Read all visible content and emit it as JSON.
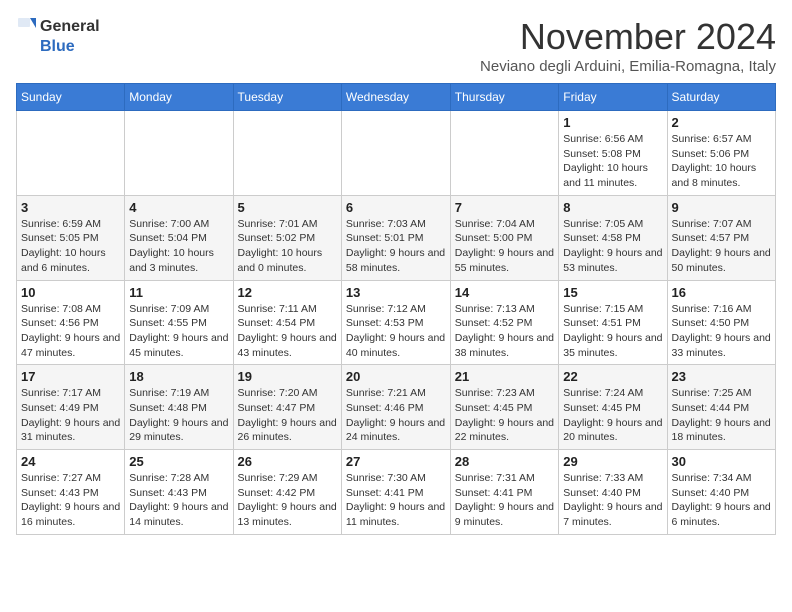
{
  "header": {
    "logo_general": "General",
    "logo_blue": "Blue",
    "month_title": "November 2024",
    "subtitle": "Neviano degli Arduini, Emilia-Romagna, Italy"
  },
  "weekdays": [
    "Sunday",
    "Monday",
    "Tuesday",
    "Wednesday",
    "Thursday",
    "Friday",
    "Saturday"
  ],
  "weeks": [
    [
      {
        "day": "",
        "info": ""
      },
      {
        "day": "",
        "info": ""
      },
      {
        "day": "",
        "info": ""
      },
      {
        "day": "",
        "info": ""
      },
      {
        "day": "",
        "info": ""
      },
      {
        "day": "1",
        "info": "Sunrise: 6:56 AM\nSunset: 5:08 PM\nDaylight: 10 hours and 11 minutes."
      },
      {
        "day": "2",
        "info": "Sunrise: 6:57 AM\nSunset: 5:06 PM\nDaylight: 10 hours and 8 minutes."
      }
    ],
    [
      {
        "day": "3",
        "info": "Sunrise: 6:59 AM\nSunset: 5:05 PM\nDaylight: 10 hours and 6 minutes."
      },
      {
        "day": "4",
        "info": "Sunrise: 7:00 AM\nSunset: 5:04 PM\nDaylight: 10 hours and 3 minutes."
      },
      {
        "day": "5",
        "info": "Sunrise: 7:01 AM\nSunset: 5:02 PM\nDaylight: 10 hours and 0 minutes."
      },
      {
        "day": "6",
        "info": "Sunrise: 7:03 AM\nSunset: 5:01 PM\nDaylight: 9 hours and 58 minutes."
      },
      {
        "day": "7",
        "info": "Sunrise: 7:04 AM\nSunset: 5:00 PM\nDaylight: 9 hours and 55 minutes."
      },
      {
        "day": "8",
        "info": "Sunrise: 7:05 AM\nSunset: 4:58 PM\nDaylight: 9 hours and 53 minutes."
      },
      {
        "day": "9",
        "info": "Sunrise: 7:07 AM\nSunset: 4:57 PM\nDaylight: 9 hours and 50 minutes."
      }
    ],
    [
      {
        "day": "10",
        "info": "Sunrise: 7:08 AM\nSunset: 4:56 PM\nDaylight: 9 hours and 47 minutes."
      },
      {
        "day": "11",
        "info": "Sunrise: 7:09 AM\nSunset: 4:55 PM\nDaylight: 9 hours and 45 minutes."
      },
      {
        "day": "12",
        "info": "Sunrise: 7:11 AM\nSunset: 4:54 PM\nDaylight: 9 hours and 43 minutes."
      },
      {
        "day": "13",
        "info": "Sunrise: 7:12 AM\nSunset: 4:53 PM\nDaylight: 9 hours and 40 minutes."
      },
      {
        "day": "14",
        "info": "Sunrise: 7:13 AM\nSunset: 4:52 PM\nDaylight: 9 hours and 38 minutes."
      },
      {
        "day": "15",
        "info": "Sunrise: 7:15 AM\nSunset: 4:51 PM\nDaylight: 9 hours and 35 minutes."
      },
      {
        "day": "16",
        "info": "Sunrise: 7:16 AM\nSunset: 4:50 PM\nDaylight: 9 hours and 33 minutes."
      }
    ],
    [
      {
        "day": "17",
        "info": "Sunrise: 7:17 AM\nSunset: 4:49 PM\nDaylight: 9 hours and 31 minutes."
      },
      {
        "day": "18",
        "info": "Sunrise: 7:19 AM\nSunset: 4:48 PM\nDaylight: 9 hours and 29 minutes."
      },
      {
        "day": "19",
        "info": "Sunrise: 7:20 AM\nSunset: 4:47 PM\nDaylight: 9 hours and 26 minutes."
      },
      {
        "day": "20",
        "info": "Sunrise: 7:21 AM\nSunset: 4:46 PM\nDaylight: 9 hours and 24 minutes."
      },
      {
        "day": "21",
        "info": "Sunrise: 7:23 AM\nSunset: 4:45 PM\nDaylight: 9 hours and 22 minutes."
      },
      {
        "day": "22",
        "info": "Sunrise: 7:24 AM\nSunset: 4:45 PM\nDaylight: 9 hours and 20 minutes."
      },
      {
        "day": "23",
        "info": "Sunrise: 7:25 AM\nSunset: 4:44 PM\nDaylight: 9 hours and 18 minutes."
      }
    ],
    [
      {
        "day": "24",
        "info": "Sunrise: 7:27 AM\nSunset: 4:43 PM\nDaylight: 9 hours and 16 minutes."
      },
      {
        "day": "25",
        "info": "Sunrise: 7:28 AM\nSunset: 4:43 PM\nDaylight: 9 hours and 14 minutes."
      },
      {
        "day": "26",
        "info": "Sunrise: 7:29 AM\nSunset: 4:42 PM\nDaylight: 9 hours and 13 minutes."
      },
      {
        "day": "27",
        "info": "Sunrise: 7:30 AM\nSunset: 4:41 PM\nDaylight: 9 hours and 11 minutes."
      },
      {
        "day": "28",
        "info": "Sunrise: 7:31 AM\nSunset: 4:41 PM\nDaylight: 9 hours and 9 minutes."
      },
      {
        "day": "29",
        "info": "Sunrise: 7:33 AM\nSunset: 4:40 PM\nDaylight: 9 hours and 7 minutes."
      },
      {
        "day": "30",
        "info": "Sunrise: 7:34 AM\nSunset: 4:40 PM\nDaylight: 9 hours and 6 minutes."
      }
    ]
  ]
}
